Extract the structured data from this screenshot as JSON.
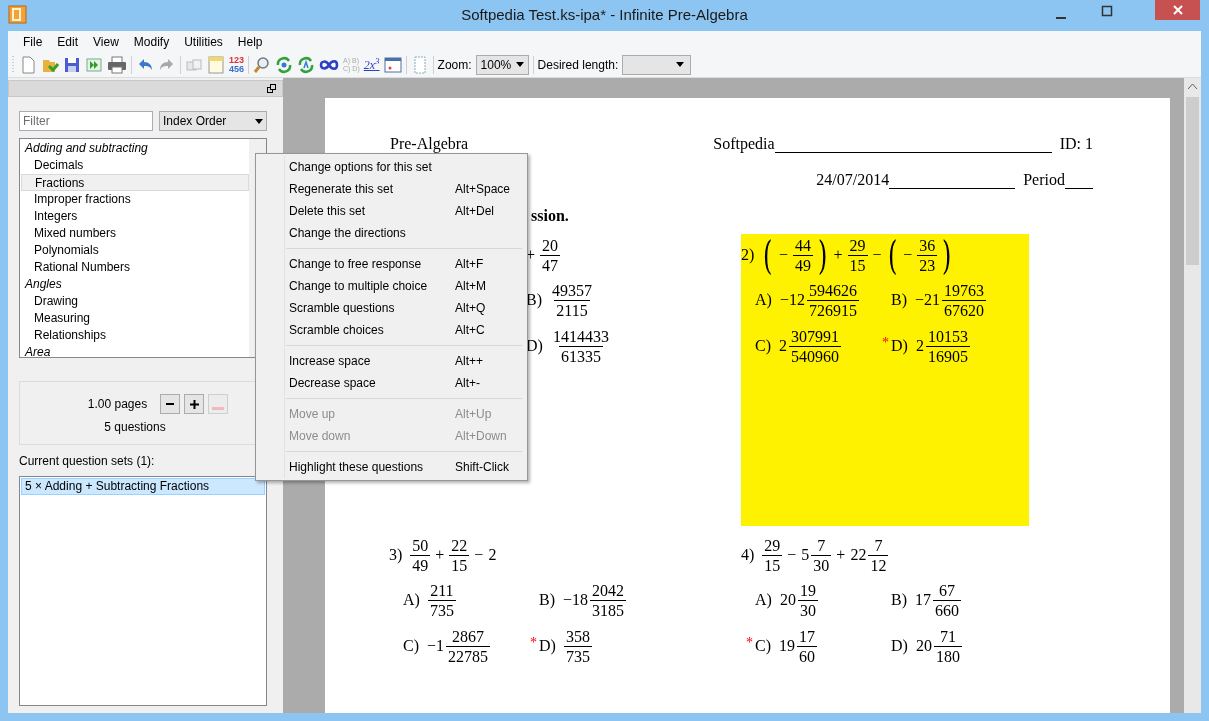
{
  "window": {
    "title": "Softpedia Test.ks-ipa* - Infinite Pre-Algebra"
  },
  "menu_bar": [
    "File",
    "Edit",
    "View",
    "Modify",
    "Utilities",
    "Help"
  ],
  "toolbar": {
    "number_icon_lines": [
      "123",
      "456"
    ],
    "choices_icon_lines": [
      "A) B)",
      "C) D)"
    ],
    "power_icon": "2x$^{3}$",
    "zoom_label": "Zoom:",
    "zoom_value": "100%",
    "length_label": "Desired length:"
  },
  "sidebar": {
    "filter_placeholder": "Filter",
    "sort": "Index Order",
    "topics": [
      {
        "label": "Adding and subtracting",
        "selected": false,
        "children": [
          {
            "label": "Decimals",
            "selected": false
          },
          {
            "label": "Fractions",
            "selected": true
          },
          {
            "label": "Improper fractions",
            "selected": false
          },
          {
            "label": "Integers",
            "selected": false
          },
          {
            "label": "Mixed numbers",
            "selected": false
          },
          {
            "label": "Polynomials",
            "selected": false
          },
          {
            "label": "Rational Numbers",
            "selected": false
          }
        ]
      },
      {
        "label": "Angles",
        "selected": false,
        "children": [
          {
            "label": "Drawing",
            "selected": false
          },
          {
            "label": "Measuring",
            "selected": false
          },
          {
            "label": "Relationships",
            "selected": false
          }
        ]
      },
      {
        "label": "Area",
        "selected": false
      }
    ],
    "pages": "1.00 pages",
    "questions": "5 questions",
    "sets_label": "Current question sets (1):",
    "sets": [
      {
        "label": "5 × Adding + Subtracting Fractions",
        "selected": true
      }
    ]
  },
  "context_menu": {
    "sections": [
      [
        {
          "label": "Change options for this set",
          "disabled": false
        },
        {
          "label": "Regenerate this set",
          "shortcut": "Alt+Space",
          "disabled": false
        },
        {
          "label": "Delete this set",
          "shortcut": "Alt+Del",
          "disabled": false
        },
        {
          "label": "Change the directions",
          "disabled": false
        }
      ],
      [
        {
          "label": "Change to free response",
          "shortcut": "Alt+F",
          "disabled": false
        },
        {
          "label": "Change to multiple choice",
          "shortcut": "Alt+M",
          "disabled": false
        },
        {
          "label": "Scramble questions",
          "shortcut": "Alt+Q",
          "disabled": false
        },
        {
          "label": "Scramble choices",
          "shortcut": "Alt+C",
          "disabled": false
        }
      ],
      [
        {
          "label": "Increase space",
          "shortcut": "Alt++",
          "disabled": false
        },
        {
          "label": "Decrease space",
          "shortcut": "Alt+-",
          "disabled": false
        }
      ],
      [
        {
          "label": "Move up",
          "shortcut": "Alt+Up",
          "disabled": true
        },
        {
          "label": "Move down",
          "shortcut": "Alt+Down",
          "disabled": true
        }
      ],
      [
        {
          "label": "Highlight these questions",
          "shortcut": "Shift-Click",
          "disabled": false
        }
      ]
    ]
  },
  "document": {
    "title": "Pre-Algebra",
    "name_label": "Softpedia",
    "id_label": "ID: 1",
    "date": "24/07/2014",
    "period_label": "Period",
    "directions": "ssion.",
    "problem_rows": [
      [
        {
          "highlighted": false,
          "expression": [
            {
              "kind": "op",
              "text": "+"
            },
            {
              "kind": "frac",
              "num": "20",
              "den": "47"
            }
          ],
          "choice_rows": [
            [
              {
                "label": "B)",
                "value": [
                  {
                    "kind": "frac",
                    "num": "49357",
                    "den": "2115"
                  }
                ]
              }
            ],
            [
              {
                "label": "D)",
                "value": [
                  {
                    "kind": "frac",
                    "num": "1414433",
                    "den": "61335"
                  }
                ]
              }
            ]
          ]
        },
        {
          "number": "2)",
          "highlighted": true,
          "expression": [
            {
              "kind": "paren",
              "text": "("
            },
            {
              "kind": "op",
              "text": "−"
            },
            {
              "kind": "frac",
              "num": "44",
              "den": "49"
            },
            {
              "kind": "paren",
              "text": ")"
            },
            {
              "kind": "op",
              "text": "+"
            },
            {
              "kind": "frac",
              "num": "29",
              "den": "15"
            },
            {
              "kind": "op",
              "text": "−"
            },
            {
              "kind": "paren",
              "text": "("
            },
            {
              "kind": "op",
              "text": "−"
            },
            {
              "kind": "frac",
              "num": "36",
              "den": "23"
            },
            {
              "kind": "paren",
              "text": ")"
            }
          ],
          "choice_rows": [
            [
              {
                "label": "A)",
                "value": [
                  {
                    "kind": "num",
                    "text": "−12"
                  },
                  {
                    "kind": "frac",
                    "num": "594626",
                    "den": "726915"
                  }
                ]
              },
              {
                "label": "B)",
                "value": [
                  {
                    "kind": "num",
                    "text": "−21"
                  },
                  {
                    "kind": "frac",
                    "num": "19763",
                    "den": "67620"
                  }
                ]
              }
            ],
            [
              {
                "label": "C)",
                "value": [
                  {
                    "kind": "num",
                    "text": "2"
                  },
                  {
                    "kind": "frac",
                    "num": "307991",
                    "den": "540960"
                  }
                ]
              },
              {
                "label": "D)",
                "marker": "*",
                "value": [
                  {
                    "kind": "num",
                    "text": "2"
                  },
                  {
                    "kind": "frac",
                    "num": "10153",
                    "den": "16905"
                  }
                ]
              }
            ]
          ]
        }
      ],
      [
        {
          "number": "3)",
          "highlighted": false,
          "expression": [
            {
              "kind": "frac",
              "num": "50",
              "den": "49"
            },
            {
              "kind": "op",
              "text": "+"
            },
            {
              "kind": "frac",
              "num": "22",
              "den": "15"
            },
            {
              "kind": "op",
              "text": "−"
            },
            {
              "kind": "num",
              "text": "2"
            }
          ],
          "choice_rows": [
            [
              {
                "label": "A)",
                "value": [
                  {
                    "kind": "frac",
                    "num": "211",
                    "den": "735"
                  }
                ]
              },
              {
                "label": "B)",
                "value": [
                  {
                    "kind": "num",
                    "text": "−18"
                  },
                  {
                    "kind": "frac",
                    "num": "2042",
                    "den": "3185"
                  }
                ]
              }
            ],
            [
              {
                "label": "C)",
                "value": [
                  {
                    "kind": "num",
                    "text": "−1"
                  },
                  {
                    "kind": "frac",
                    "num": "2867",
                    "den": "22785"
                  }
                ]
              },
              {
                "label": "D)",
                "marker": "*",
                "value": [
                  {
                    "kind": "frac",
                    "num": "358",
                    "den": "735"
                  }
                ]
              }
            ]
          ]
        },
        {
          "number": "4)",
          "highlighted": false,
          "expression": [
            {
              "kind": "frac",
              "num": "29",
              "den": "15"
            },
            {
              "kind": "op",
              "text": "−"
            },
            {
              "kind": "num",
              "text": "5"
            },
            {
              "kind": "frac",
              "num": "7",
              "den": "30"
            },
            {
              "kind": "op",
              "text": "+"
            },
            {
              "kind": "num",
              "text": "22"
            },
            {
              "kind": "frac",
              "num": "7",
              "den": "12"
            }
          ],
          "choice_rows": [
            [
              {
                "label": "A)",
                "value": [
                  {
                    "kind": "num",
                    "text": "20"
                  },
                  {
                    "kind": "frac",
                    "num": "19",
                    "den": "30"
                  }
                ]
              },
              {
                "label": "B)",
                "value": [
                  {
                    "kind": "num",
                    "text": "17"
                  },
                  {
                    "kind": "frac",
                    "num": "67",
                    "den": "660"
                  }
                ]
              }
            ],
            [
              {
                "label": "C)",
                "marker": "*",
                "value": [
                  {
                    "kind": "num",
                    "text": "19"
                  },
                  {
                    "kind": "frac",
                    "num": "17",
                    "den": "60"
                  }
                ]
              },
              {
                "label": "D)",
                "value": [
                  {
                    "kind": "num",
                    "text": "20"
                  },
                  {
                    "kind": "frac",
                    "num": "71",
                    "den": "180"
                  }
                ]
              }
            ]
          ]
        }
      ]
    ]
  }
}
